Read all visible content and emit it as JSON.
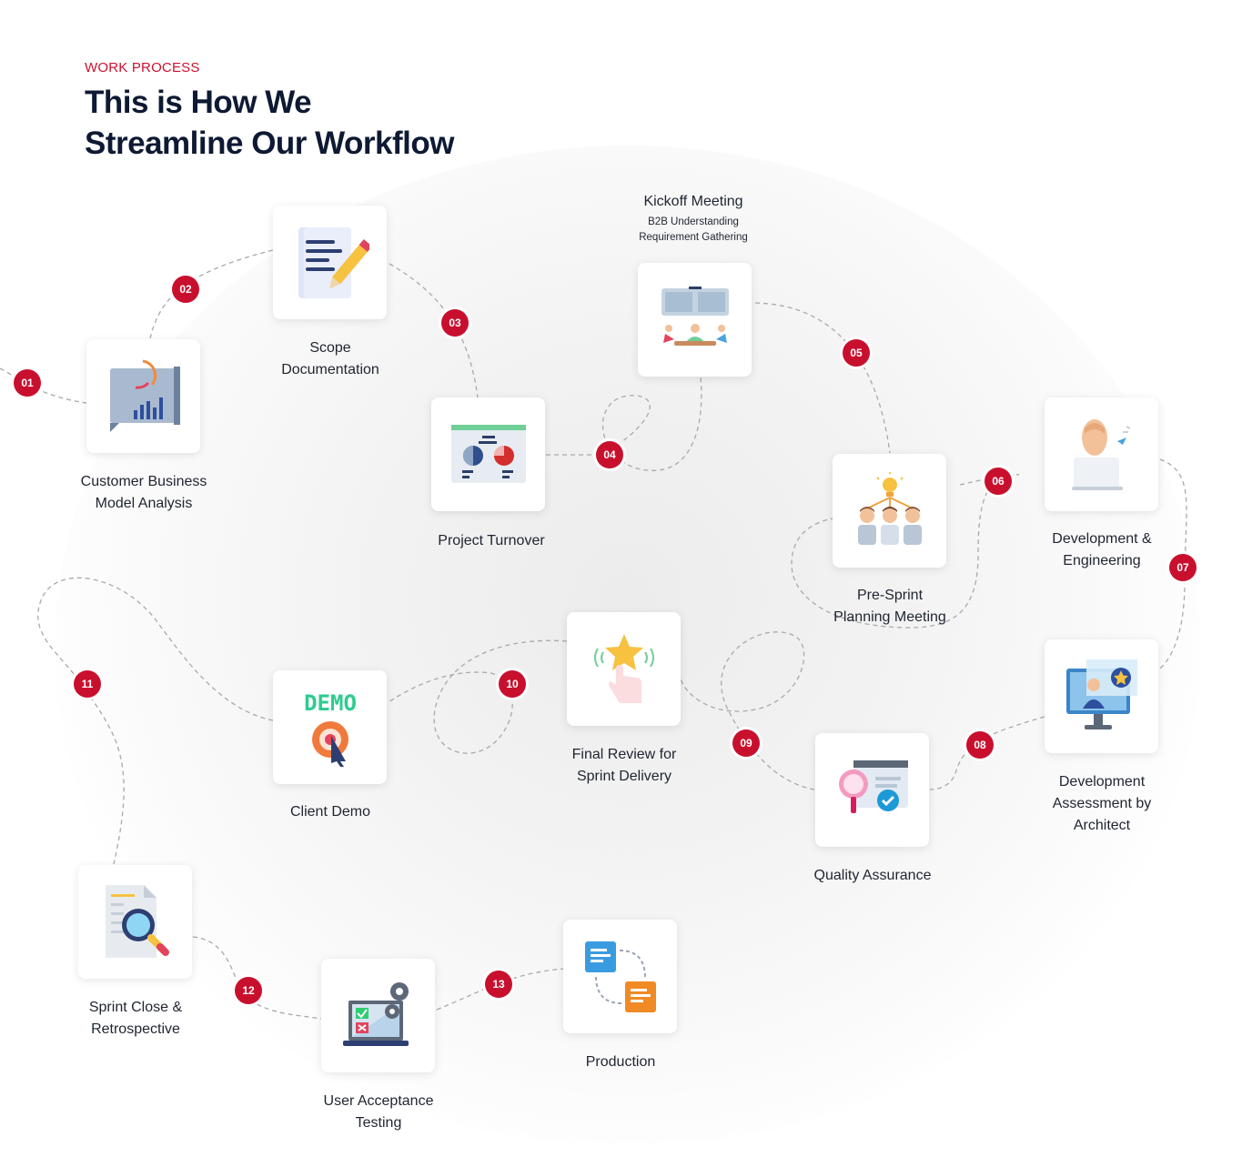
{
  "header": {
    "eyebrow": "WORK PROCESS",
    "title": "This is How We\nStreamline Our Workflow"
  },
  "colors": {
    "accent": "#c8102e",
    "title": "#0e1a33"
  },
  "steps": [
    {
      "number": "01",
      "label": "Customer Business\nModel Analysis",
      "icon": "analysis-icon"
    },
    {
      "number": "02",
      "label": "Scope\nDocumentation",
      "icon": "document-pencil-icon"
    },
    {
      "number": "03",
      "label": "Project Turnover",
      "icon": "presentation-chart-icon"
    },
    {
      "number": "04",
      "label": "Kickoff Meeting",
      "sublabel": "B2B Understanding\nRequirement Gathering",
      "icon": "meeting-icon"
    },
    {
      "number": "05",
      "label": "Pre-Sprint\nPlanning Meeting",
      "icon": "team-idea-icon"
    },
    {
      "number": "06",
      "label": "Development &\nEngineering",
      "icon": "developer-icon"
    },
    {
      "number": "07",
      "label": "Development\nAssessment by\nArchitect",
      "icon": "monitor-user-icon"
    },
    {
      "number": "08",
      "label": "Quality Assurance",
      "icon": "magnifier-check-icon"
    },
    {
      "number": "09",
      "label": "Final Review for\nSprint Delivery",
      "icon": "star-tap-icon"
    },
    {
      "number": "10",
      "label": "Client Demo",
      "icon": "demo-cursor-icon"
    },
    {
      "number": "11",
      "label": "Sprint Close &\nRetrospective",
      "icon": "document-search-icon"
    },
    {
      "number": "12",
      "label": "User Acceptance\nTesting",
      "icon": "laptop-checklist-icon"
    },
    {
      "number": "13",
      "label": "Production",
      "icon": "documents-sync-icon"
    }
  ],
  "icon_texts": {
    "demo": "DEMO"
  }
}
